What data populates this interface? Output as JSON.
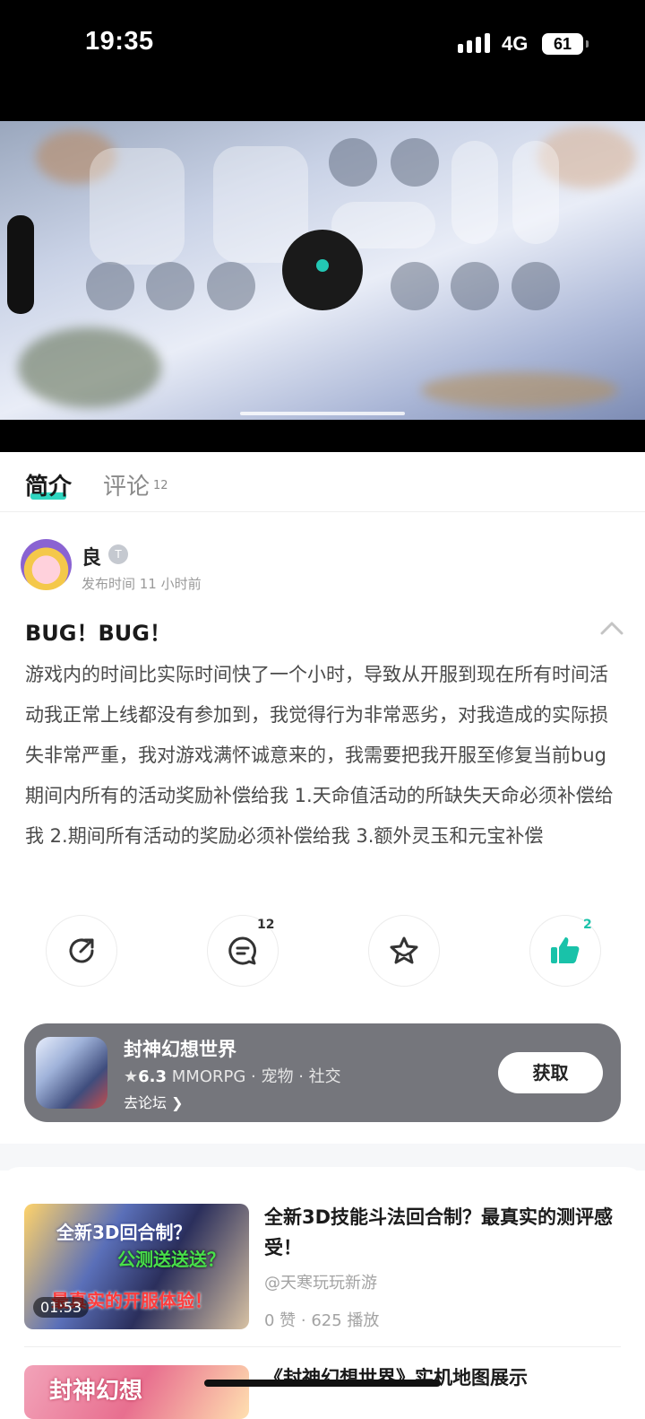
{
  "status_bar": {
    "time": "19:35",
    "network": "4G",
    "battery": "61"
  },
  "tabs": {
    "intro": "简介",
    "comments": "评论",
    "comments_count": "12"
  },
  "post": {
    "author": "良",
    "author_badge": "T",
    "publish_time": "发布时间 11 小时前",
    "title": "BUG！BUG！",
    "body": "游戏内的时间比实际时间快了一个小时，导致从开服到现在所有时间活动我正常上线都没有参加到，我觉得行为非常恶劣，对我造成的实际损失非常严重，我对游戏满怀诚意来的，我需要把我开服至修复当前bug期间内所有的活动奖励补偿给我 1.天命值活动的所缺失天命必须补偿给我 2.期间所有活动的奖励必须补偿给我 3.额外灵玉和元宝补偿"
  },
  "actions": {
    "comment_count": "12",
    "like_count": "2"
  },
  "game_card": {
    "name": "封神幻想世界",
    "rating": "6.3",
    "tags": "MMORPG · 宠物 · 社交",
    "forum_link": "去论坛",
    "get_button": "获取"
  },
  "recommendations": [
    {
      "title": "全新3D技能斗法回合制？最真实的测评感受！",
      "author": "@天寒玩玩新游",
      "stats": "0 赞 · 625 播放",
      "duration": "01:53",
      "thumb_line1": "全新3D回合制？",
      "thumb_line2": "公测送送送？",
      "thumb_line3": "最真实的开服体验！"
    },
    {
      "title": "《封神幻想世界》实机地图展示",
      "thumb_text": "封神幻想"
    }
  ],
  "colors": {
    "accent": "#2fd6c0",
    "like": "#19c2a9",
    "card_bg": "#75767c"
  }
}
